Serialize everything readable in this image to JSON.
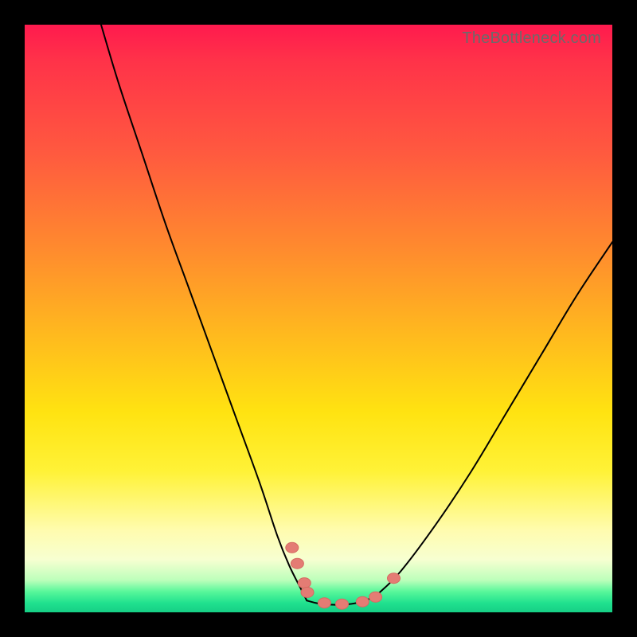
{
  "watermark": "TheBottleneck.com",
  "colors": {
    "frame": "#000000",
    "curve": "#000000",
    "bead": "#e47c74",
    "gradient_top": "#ff1a4e",
    "gradient_bottom": "#16cf85"
  },
  "chart_data": {
    "type": "line",
    "title": "",
    "xlabel": "",
    "ylabel": "",
    "xlim": [
      0,
      100
    ],
    "ylim": [
      0,
      100
    ],
    "annotations": [
      "TheBottleneck.com"
    ],
    "series": [
      {
        "name": "left-branch",
        "x": [
          13,
          16,
          20,
          24,
          28,
          32,
          36,
          40,
          43,
          45,
          47,
          48
        ],
        "y": [
          100,
          90,
          78,
          66,
          55,
          44,
          33,
          22,
          13,
          8,
          4,
          2
        ]
      },
      {
        "name": "valley-floor",
        "x": [
          48,
          50,
          52,
          54,
          56,
          58,
          60
        ],
        "y": [
          2,
          1.5,
          1.3,
          1.3,
          1.5,
          2,
          3
        ]
      },
      {
        "name": "right-branch",
        "x": [
          60,
          64,
          70,
          76,
          82,
          88,
          94,
          100
        ],
        "y": [
          3,
          7,
          15,
          24,
          34,
          44,
          54,
          63
        ]
      }
    ],
    "markers": {
      "name": "beads",
      "approx_shape": "rounded",
      "points": [
        {
          "x": 45.5,
          "y": 11.0
        },
        {
          "x": 46.4,
          "y": 8.3
        },
        {
          "x": 47.6,
          "y": 5.0
        },
        {
          "x": 48.1,
          "y": 3.4
        },
        {
          "x": 51.0,
          "y": 1.6
        },
        {
          "x": 54.0,
          "y": 1.4
        },
        {
          "x": 57.5,
          "y": 1.8
        },
        {
          "x": 59.7,
          "y": 2.6
        },
        {
          "x": 62.8,
          "y": 5.8
        }
      ]
    }
  }
}
